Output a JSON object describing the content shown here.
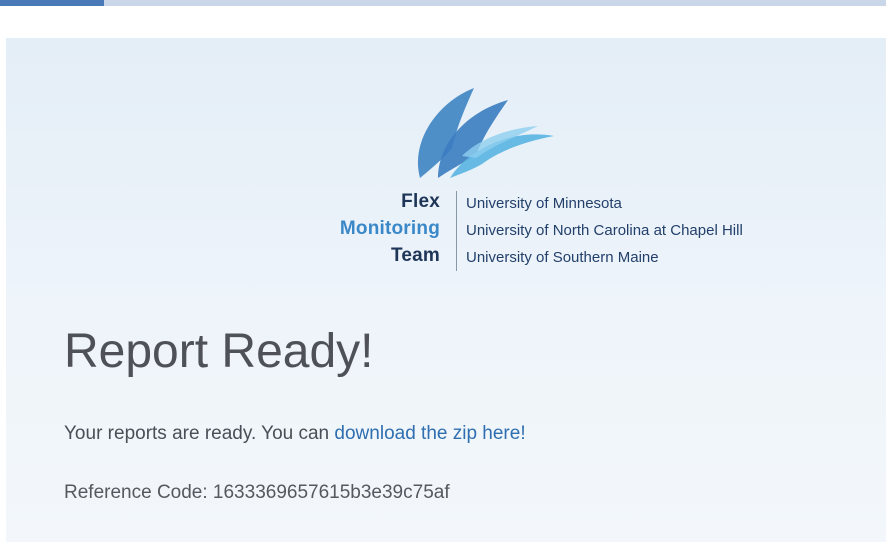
{
  "logo": {
    "icon": "sail-wave-logo-icon",
    "name_line1": "Flex",
    "name_line2": "Monitoring",
    "name_line3": "Team",
    "universities": [
      "University of Minnesota",
      "University of North Carolina at Chapel Hill",
      "University of Southern Maine"
    ]
  },
  "page": {
    "title": "Report Ready!",
    "message_prefix": "Your reports are ready. You can ",
    "download_link": "download the zip here!",
    "reference_label": "Reference Code: ",
    "reference_code": "1633369657615b3e39c75af"
  },
  "colors": {
    "header_strip": "#c9d7e8",
    "header_accent": "#4a79b8",
    "panel_background": "#e9f1f9",
    "logo_dark": "#1d3557",
    "logo_blue": "#3b88c9",
    "logo_light": "#5bb4e2",
    "link": "#2f6fb0",
    "title_text": "#4e5157"
  }
}
